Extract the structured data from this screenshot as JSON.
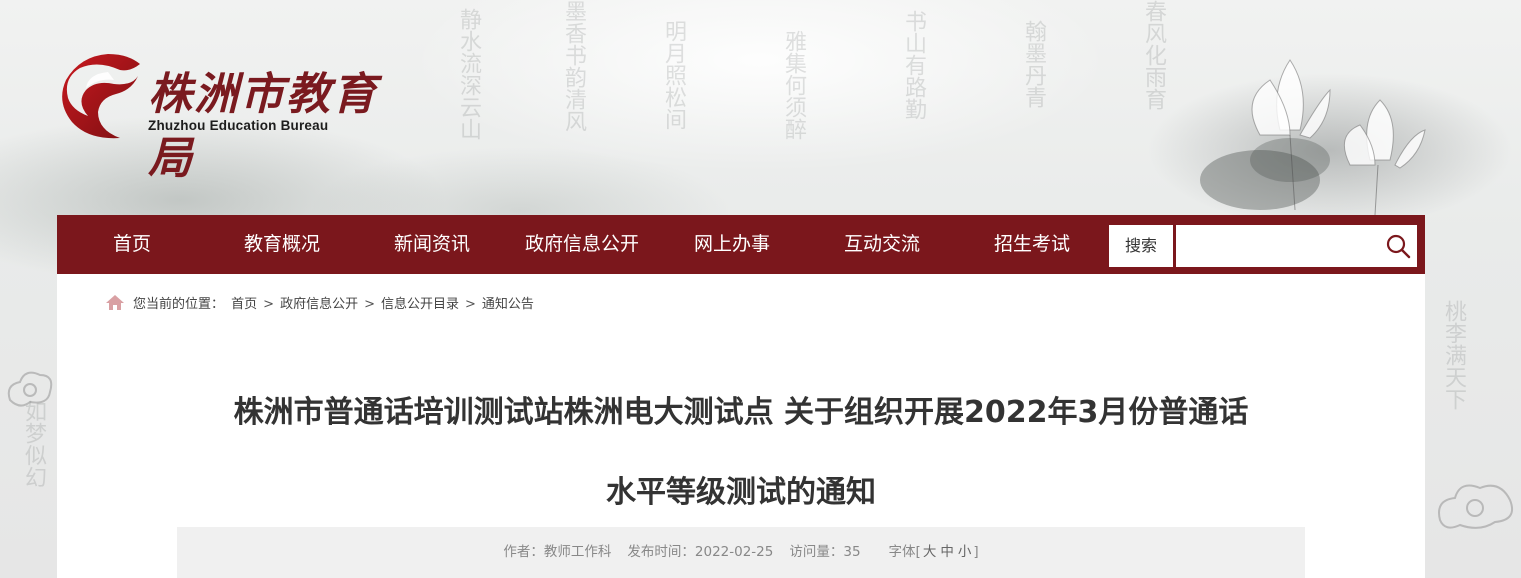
{
  "brand": {
    "name_cn": "株洲市教育局",
    "name_en": "Zhuzhou Education Bureau",
    "color": "#7b171c"
  },
  "nav": {
    "items": [
      "首页",
      "教育概况",
      "新闻资讯",
      "政府信息公开",
      "网上办事",
      "互动交流",
      "招生考试"
    ],
    "search_label": "搜索",
    "search_value": "",
    "search_icon": "search-icon"
  },
  "breadcrumb": {
    "prefix": "您当前的位置：",
    "items": [
      "首页",
      "政府信息公开",
      "信息公开目录",
      "通知公告"
    ],
    "separator": ">",
    "icon": "home-icon"
  },
  "article": {
    "title_line1": "株洲市普通话培训测试站株洲电大测试点 关于组织开展2022年3月份普通话",
    "title_line2": "水平等级测试的通知",
    "author_label": "作者：",
    "author": "教师工作科",
    "date_label": "发布时间：",
    "date": "2022-02-25",
    "views_label": "访问量：",
    "views": "35",
    "font_label": "字体[",
    "font_sizes": [
      "大",
      "中",
      "小"
    ],
    "font_close": "]"
  },
  "background": {
    "calligraphy": [
      "静水流深云山",
      "墨香书韵清风",
      "明月照松间",
      "雅集何须醉",
      "书山有路勤",
      "翰墨丹青",
      "春风化雨育",
      "桃李满天下",
      "如梦似幻"
    ]
  }
}
